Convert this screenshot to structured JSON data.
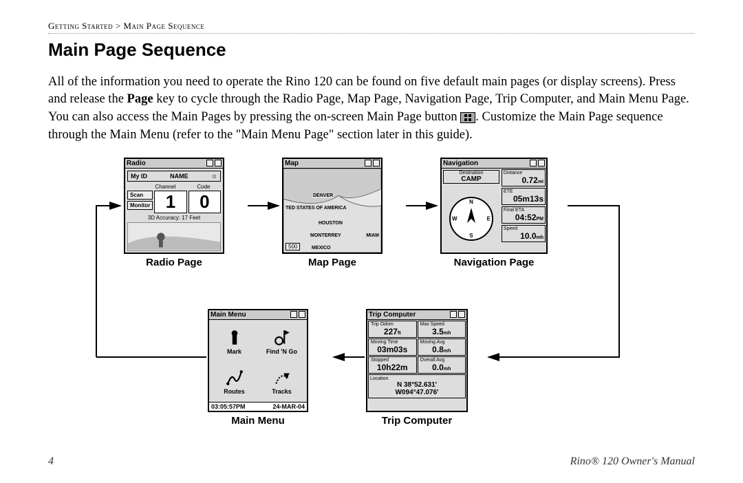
{
  "breadcrumb": "Getting Started > Main Page Sequence",
  "heading": "Main Page Sequence",
  "para_1": "All of the information you need to operate the Rino 120 can be found on five default main pages (or display screens). Press and release the ",
  "bold_page": "Page",
  "para_2": " key to cycle through the Radio Page, Map Page, Navigation Page, Trip Computer, and Main Menu Page. You can also access the Main Pages by pressing the on-screen Main Page button ",
  "para_3": ". Customize the Main Page sequence through the Main Menu (refer to the \"Main Menu Page\" section later in this guide).",
  "captions": {
    "radio": "Radio Page",
    "map": "Map Page",
    "nav": "Navigation Page",
    "menu": "Main Menu",
    "trip": "Trip Computer"
  },
  "radio": {
    "title": "Radio",
    "id_label": "My ID",
    "id_value": "NAME",
    "channel_label": "Channel",
    "code_label": "Code",
    "scan": "Scan",
    "monitor": "Monitor",
    "channel": "1",
    "code": "0",
    "accuracy": "3D Accuracy: 17 Feet"
  },
  "map": {
    "title": "Map",
    "denver": "DENVER",
    "usa": "TED STATES OF AMERICA",
    "houston": "HOUSTON",
    "monterrey": "MONTERREY",
    "miami": "MIAM",
    "mexico": "MEXICO",
    "scale": "500"
  },
  "nav": {
    "title": "Navigation",
    "dest_label": "Destination",
    "dest": "CAMP",
    "distance_label": "Distance",
    "distance": "0.72",
    "distance_unit": "mi",
    "ete_label": "ETE",
    "ete": "05m13s",
    "eta_label": "Final ETA",
    "eta": "04:52",
    "eta_unit": "PM",
    "speed_label": "Speed",
    "speed": "10.0",
    "speed_unit": "mh"
  },
  "menu": {
    "title": "Main Menu",
    "mark": "Mark",
    "find": "Find 'N Go",
    "routes": "Routes",
    "tracks": "Tracks",
    "time": "03:05:57PM",
    "date": "24-MAR-04"
  },
  "trip": {
    "title": "Trip Computer",
    "odom_label": "Trip Odom",
    "odom": "227",
    "odom_unit": "ft",
    "maxspd_label": "Max Speed",
    "maxspd": "3.5",
    "maxspd_unit": "mh",
    "movtime_label": "Moving Time",
    "movtime": "03m03s",
    "movavg_label": "Moving Avg",
    "movavg": "0.8",
    "movavg_unit": "mh",
    "stopped_label": "Stopped",
    "stopped": "10h22m",
    "ovavg_label": "Overall Avg",
    "ovavg": "0.0",
    "ovavg_unit": "mh",
    "loc_label": "Location",
    "lat": "N  38°52.631'",
    "lon": "W094°47.076'"
  },
  "footer": {
    "page": "4",
    "manual": "Rino® 120 Owner's Manual"
  }
}
